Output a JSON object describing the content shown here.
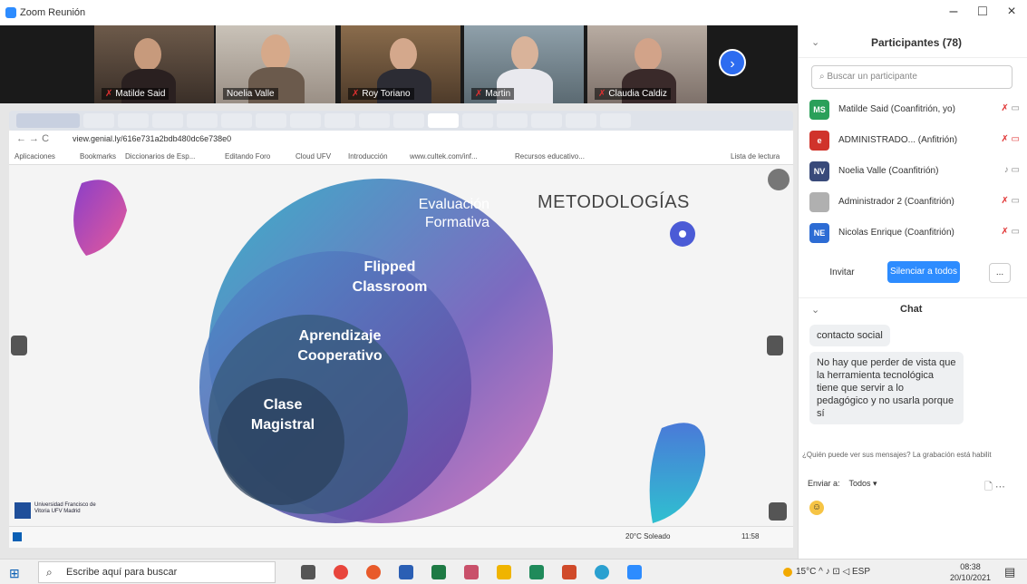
{
  "window": {
    "title": "Zoom Reunión",
    "controls": [
      "–",
      "□",
      "×"
    ]
  },
  "video_strip": {
    "participants": [
      {
        "name": "Matilde Said",
        "muted": true
      },
      {
        "name": "Noelia Valle",
        "muted": false
      },
      {
        "name": "Roy Toriano",
        "muted": true
      },
      {
        "name": "Martin",
        "muted": true
      },
      {
        "name": "Claudia Caldiz",
        "muted": true
      }
    ]
  },
  "browser": {
    "url": "view.genial.ly/616e731a2bdb480dc6e738e0",
    "bookmarks": [
      "Aplicaciones",
      "Bookmarks",
      "Diccionarios de Esp...",
      "Editando Foro",
      "Cloud UFV",
      "Introducción",
      "www.cultek.com/inf...",
      "Recursos educativo...",
      "Lista de lectura"
    ]
  },
  "slide": {
    "title": "METODOLOGÍAS",
    "circles": [
      "Evaluación Formativa",
      "Flipped Classroom",
      "Aprendizaje Cooperativo",
      "Clase Magistral"
    ],
    "logo_text": "Universidad Francisco de Vitoria UFV Madrid"
  },
  "inner_taskbar": {
    "weather": "20°C Soleado",
    "time": "11:58"
  },
  "participants_panel": {
    "title": "Participantes (78)",
    "search_placeholder": "Buscar un participante",
    "list": [
      {
        "initials": "MS",
        "name": "Matilde Said (Coanfitrión, yo)",
        "color": "#2aa05a"
      },
      {
        "initials": "",
        "name": "ADMINISTRADO... (Anfitrión)",
        "color": "#d0332b"
      },
      {
        "initials": "NV",
        "name": "Noelia Valle (Coanfitrión)",
        "color": "#394a7a"
      },
      {
        "initials": "",
        "name": "Administrador 2 (Coanfitrión)",
        "color": "#b0b0b0"
      },
      {
        "initials": "NE",
        "name": "Nicolas Enrique (Coanfitrión)",
        "color": "#2d6cd4"
      }
    ],
    "invite": "Invitar",
    "mute_all": "Silenciar a todos",
    "more": "..."
  },
  "chat": {
    "title": "Chat",
    "messages": [
      "contacto social",
      "No hay que perder de vista que la herramienta tecnológica tiene que servir a lo pedagógico y no usarla porque sí"
    ],
    "notice": "¿Quién puede ver sus mensajes? La grabación está habilit",
    "send_to_label": "Enviar a:",
    "send_to_value": "Todos ▾"
  },
  "taskbar": {
    "search_placeholder": "Escribe aquí para buscar",
    "weather": "15°C",
    "lang": "ESP",
    "time": "08:38",
    "date": "20/10/2021"
  },
  "colors": {
    "zoom_blue": "#2d8cff",
    "slide_grad_1": "#3bb0c9",
    "slide_grad_2": "#7a3fb0"
  }
}
